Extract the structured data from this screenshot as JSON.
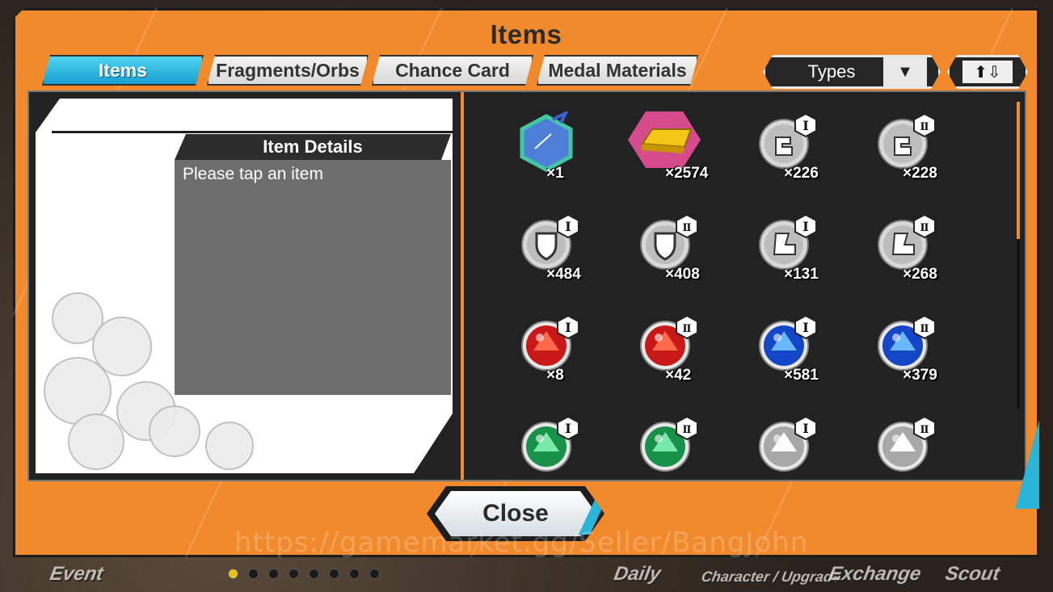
{
  "dialog": {
    "title": "Items"
  },
  "tabs": [
    {
      "label": "Items",
      "active": true
    },
    {
      "label": "Fragments/Orbs",
      "active": false
    },
    {
      "label": "Chance Card",
      "active": false
    },
    {
      "label": "Medal Materials",
      "active": false
    }
  ],
  "sort": {
    "label": "Types",
    "dropdown_icon": "triangle-down-icon",
    "order_icon": "sort-up-down-icon"
  },
  "details": {
    "header": "Item Details",
    "hint": "Please tap an item"
  },
  "items": [
    {
      "icon": "spirit-ribbon-hexagon-icon",
      "qty": "×1",
      "rank": ""
    },
    {
      "icon": "gold-bar-icon",
      "qty": "×2574",
      "rank": ""
    },
    {
      "icon": "power-fist-medal-icon",
      "qty": "×226",
      "rank": "I"
    },
    {
      "icon": "power-fist-medal-icon",
      "qty": "×228",
      "rank": "II"
    },
    {
      "icon": "shield-medal-icon",
      "qty": "×484",
      "rank": "I"
    },
    {
      "icon": "shield-medal-icon",
      "qty": "×408",
      "rank": "II"
    },
    {
      "icon": "boot-medal-icon",
      "qty": "×131",
      "rank": "I"
    },
    {
      "icon": "boot-medal-icon",
      "qty": "×268",
      "rank": "II"
    },
    {
      "icon": "red-orb-icon",
      "qty": "×8",
      "rank": "I"
    },
    {
      "icon": "red-orb-icon",
      "qty": "×42",
      "rank": "II"
    },
    {
      "icon": "blue-orb-icon",
      "qty": "×581",
      "rank": "I"
    },
    {
      "icon": "blue-orb-icon",
      "qty": "×379",
      "rank": "II"
    },
    {
      "icon": "green-orb-icon",
      "qty": "",
      "rank": "I"
    },
    {
      "icon": "green-orb-icon",
      "qty": "",
      "rank": "II"
    },
    {
      "icon": "white-orb-icon",
      "qty": "",
      "rank": "I"
    },
    {
      "icon": "white-orb-icon",
      "qty": "",
      "rank": "II"
    }
  ],
  "close_label": "Close",
  "hud": {
    "labels": [
      "Event",
      "Daily",
      "Character / Upgrade",
      "Exchange",
      "Scout"
    ]
  },
  "watermark": "https://gamemarket.gg/Seller/BangJohn",
  "colors": {
    "frame": "#f08a2c",
    "tab_active": "#1a9fd0",
    "panel": "#222222"
  }
}
